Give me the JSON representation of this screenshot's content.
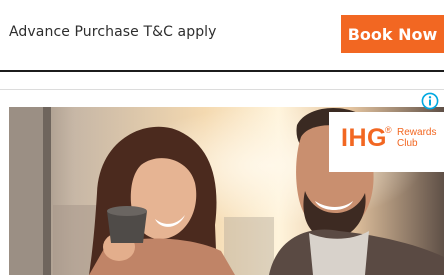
{
  "offer": {
    "terms_text": "Advance Purchase T&C apply",
    "book_label": "Book Now"
  },
  "ad": {
    "brand_mark": "IHG",
    "registered_mark": "®",
    "rewards_line1": "Rewards",
    "rewards_line2": "Club",
    "info_icon": "info-icon",
    "colors": {
      "brand_orange": "#f26722",
      "info_blue": "#00a8e1"
    }
  }
}
